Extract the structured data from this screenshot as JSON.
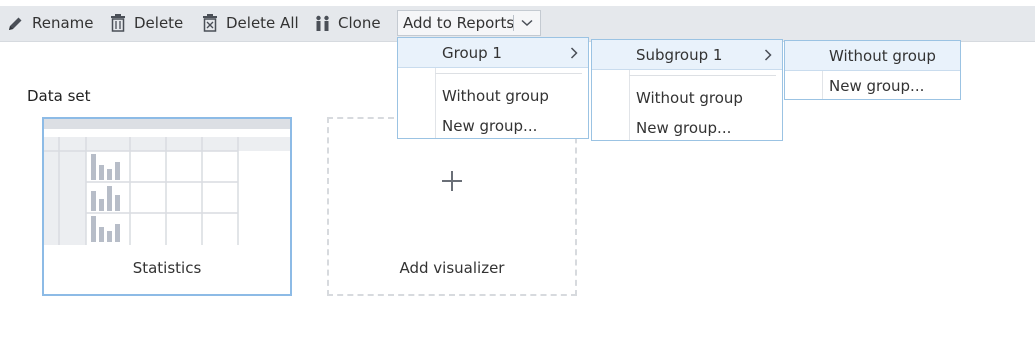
{
  "toolbar": {
    "rename_label": "Rename",
    "delete_label": "Delete",
    "delete_all_label": "Delete All",
    "clone_label": "Clone",
    "add_to_reports_label": "Add to Reports"
  },
  "section": {
    "title": "Data set"
  },
  "cards": {
    "statistics_label": "Statistics",
    "add_visualizer_label": "Add visualizer"
  },
  "menus": {
    "level1": {
      "group": "Group 1",
      "without_group": "Without group",
      "new_group": "New group..."
    },
    "level2": {
      "subgroup": "Subgroup 1",
      "without_group": "Without group",
      "new_group": "New group..."
    },
    "level3": {
      "without_group": "Without group",
      "new_group": "New group..."
    }
  },
  "icons": {
    "rename": "pencil-icon",
    "delete": "trash-icon",
    "delete_all": "trash-all-icon",
    "clone": "clone-icon",
    "dropdown": "chevron-down-icon",
    "submenu": "chevron-right-icon",
    "add": "plus-icon"
  },
  "colors": {
    "toolbar_bg": "#e5e8ec",
    "selected_border": "#8dbbe6",
    "menu_border": "#9bc3e3",
    "menu_highlight": "#e9f2fb",
    "thumb_bar": "#b7bdc8"
  }
}
